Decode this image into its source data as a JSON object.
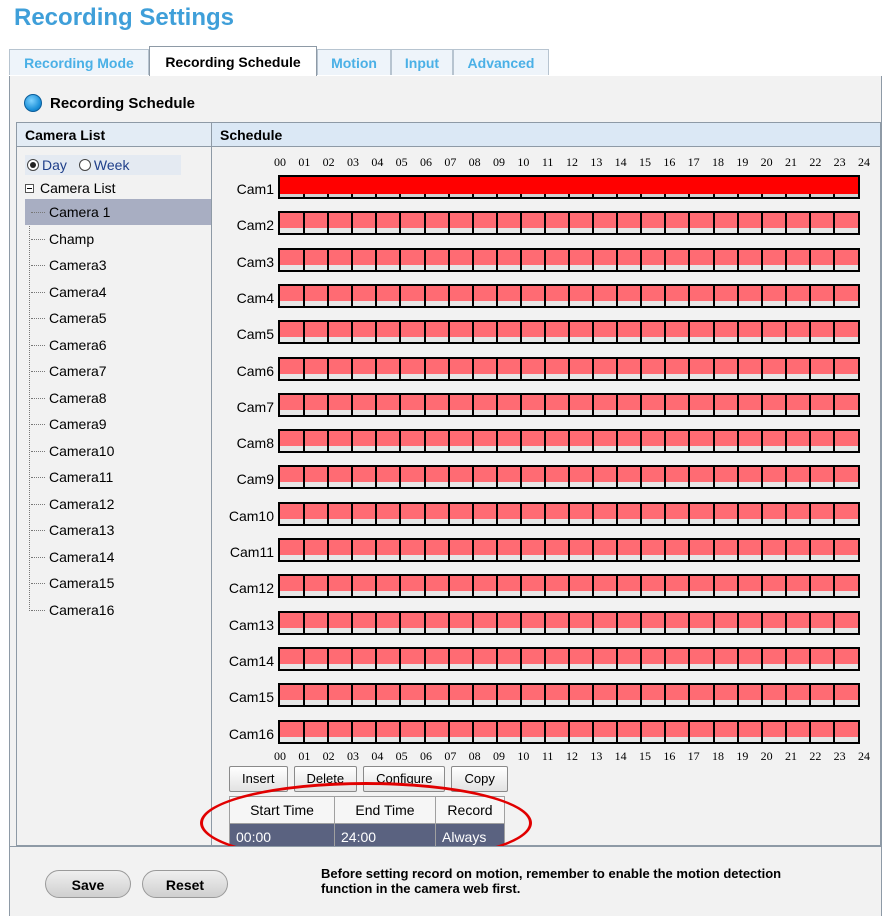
{
  "page": {
    "title": "Recording Settings"
  },
  "tabs": [
    {
      "label": "Recording Mode",
      "active": false
    },
    {
      "label": "Recording Schedule",
      "active": true
    },
    {
      "label": "Motion",
      "active": false
    },
    {
      "label": "Input",
      "active": false
    },
    {
      "label": "Advanced",
      "active": false
    }
  ],
  "section": {
    "title": "Recording Schedule"
  },
  "camera_list": {
    "header": "Camera List",
    "view_options": [
      {
        "label": "Day",
        "checked": true
      },
      {
        "label": "Week",
        "checked": false
      }
    ],
    "root_label": "Camera List",
    "items": [
      "Camera 1",
      "Champ",
      "Camera3",
      "Camera4",
      "Camera5",
      "Camera6",
      "Camera7",
      "Camera8",
      "Camera9",
      "Camera10",
      "Camera11",
      "Camera12",
      "Camera13",
      "Camera14",
      "Camera15",
      "Camera16"
    ],
    "selected_index": 0
  },
  "schedule": {
    "header": "Schedule",
    "hours": [
      "00",
      "01",
      "02",
      "03",
      "04",
      "05",
      "06",
      "07",
      "08",
      "09",
      "10",
      "11",
      "12",
      "13",
      "14",
      "15",
      "16",
      "17",
      "18",
      "19",
      "20",
      "21",
      "22",
      "23",
      "24"
    ],
    "rows": [
      {
        "label": "Cam1",
        "start": "00:00",
        "end": "24:00",
        "selected": true
      },
      {
        "label": "Cam2",
        "start": "00:00",
        "end": "24:00",
        "selected": false
      },
      {
        "label": "Cam3",
        "start": "00:00",
        "end": "24:00",
        "selected": false
      },
      {
        "label": "Cam4",
        "start": "00:00",
        "end": "24:00",
        "selected": false
      },
      {
        "label": "Cam5",
        "start": "00:00",
        "end": "24:00",
        "selected": false
      },
      {
        "label": "Cam6",
        "start": "00:00",
        "end": "24:00",
        "selected": false
      },
      {
        "label": "Cam7",
        "start": "00:00",
        "end": "24:00",
        "selected": false
      },
      {
        "label": "Cam8",
        "start": "00:00",
        "end": "24:00",
        "selected": false
      },
      {
        "label": "Cam9",
        "start": "00:00",
        "end": "24:00",
        "selected": false
      },
      {
        "label": "Cam10",
        "start": "00:00",
        "end": "24:00",
        "selected": false
      },
      {
        "label": "Cam11",
        "start": "00:00",
        "end": "24:00",
        "selected": false
      },
      {
        "label": "Cam12",
        "start": "00:00",
        "end": "24:00",
        "selected": false
      },
      {
        "label": "Cam13",
        "start": "00:00",
        "end": "24:00",
        "selected": false
      },
      {
        "label": "Cam14",
        "start": "00:00",
        "end": "24:00",
        "selected": false
      },
      {
        "label": "Cam15",
        "start": "00:00",
        "end": "24:00",
        "selected": false
      },
      {
        "label": "Cam16",
        "start": "00:00",
        "end": "24:00",
        "selected": false
      }
    ],
    "colors": {
      "selected_bar": "#ff0000",
      "bar": "#ff6b73",
      "grid": "#000000"
    }
  },
  "actions": {
    "insert": "Insert",
    "delete": "Delete",
    "configure": "Configure",
    "copy": "Copy"
  },
  "record_table": {
    "headers": [
      "Start Time",
      "End Time",
      "Record"
    ],
    "rows": [
      [
        "00:00",
        "24:00",
        "Always"
      ]
    ]
  },
  "footer": {
    "save": "Save",
    "reset": "Reset",
    "note_line1": "Before setting record on motion, remember to enable the motion detection",
    "note_line2": "function in the camera web first."
  }
}
